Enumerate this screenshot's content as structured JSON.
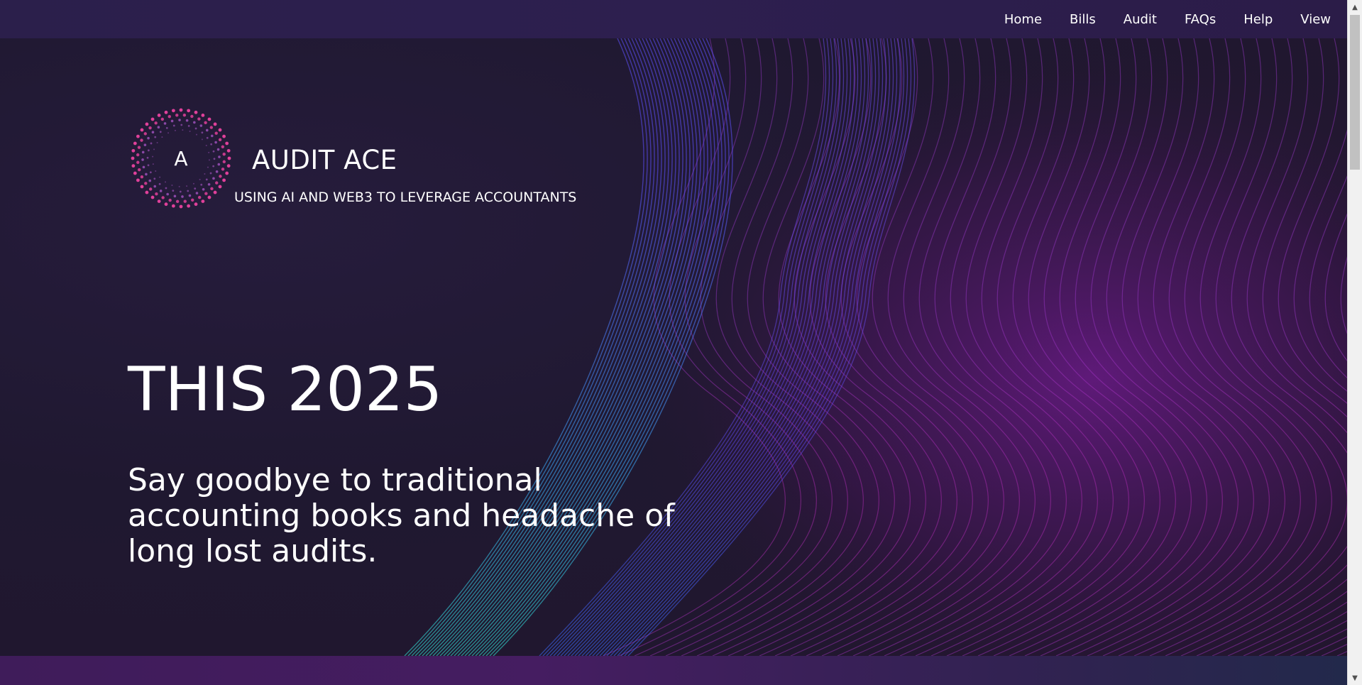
{
  "nav": {
    "items": [
      {
        "label": "Home"
      },
      {
        "label": "Bills"
      },
      {
        "label": "Audit"
      },
      {
        "label": "FAQs"
      },
      {
        "label": "Help"
      },
      {
        "label": "View"
      }
    ]
  },
  "brand": {
    "logo_letter": "A",
    "name": "AUDIT ACE",
    "tagline": "USING AI AND WEB3 TO LEVERAGE ACCOUNTANTS"
  },
  "hero": {
    "heading": "THIS 2025",
    "subheading": "Say goodbye to traditional accounting books and headache of long lost audits."
  },
  "colors": {
    "nav_bg": "#2b1f4b",
    "hero_bg": "#1f1830",
    "accent_teal": "#2fd6c8",
    "accent_blue": "#4b5cff",
    "accent_magenta": "#b52ad8",
    "logo_dots": "#e0409a"
  },
  "icons": {
    "scroll_up": "triangle-up-icon",
    "scroll_down": "triangle-down-icon"
  }
}
